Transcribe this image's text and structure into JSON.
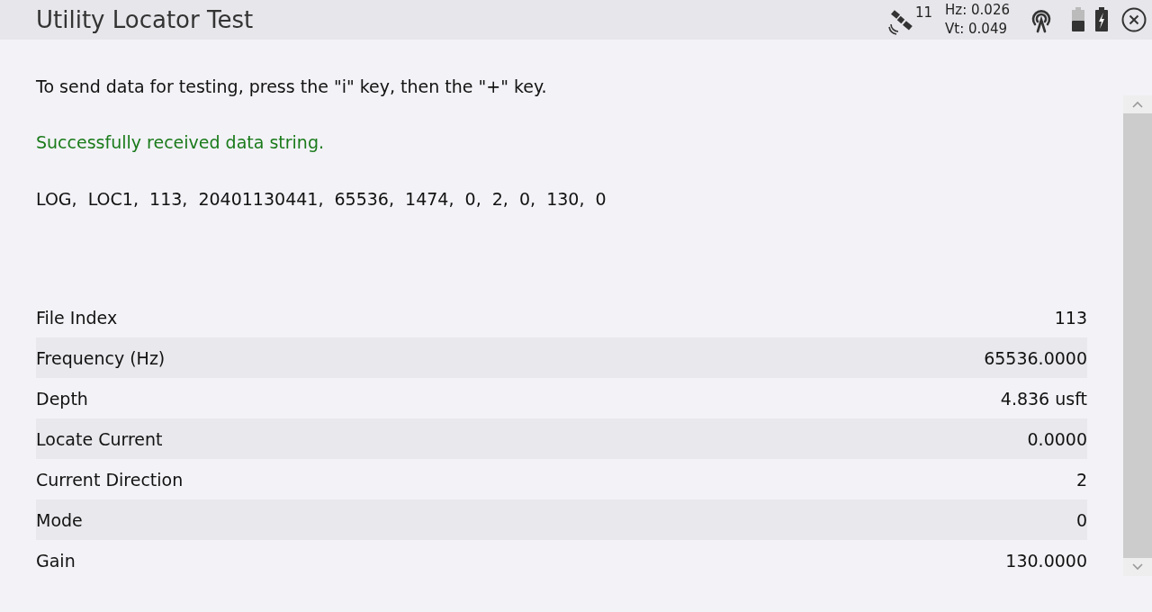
{
  "window": {
    "title": "Utility Locator Test"
  },
  "status": {
    "satellites": "11",
    "hz": "Hz: 0.026",
    "vt": "Vt: 0.049"
  },
  "instruction": "To send data for testing, press the \"i\" key, then the \"+\" key.",
  "result": "Successfully received data string.",
  "data_string": "LOG,  LOC1,  113,  20401130441,  65536,  1474,  0,  2,  0,  130,  0",
  "fields": [
    {
      "label": "File Index",
      "value": "113"
    },
    {
      "label": "Frequency (Hz)",
      "value": "65536.0000"
    },
    {
      "label": "Depth",
      "value": "4.836 usft"
    },
    {
      "label": "Locate Current",
      "value": "0.0000"
    },
    {
      "label": "Current Direction",
      "value": "2"
    },
    {
      "label": "Mode",
      "value": "0"
    },
    {
      "label": "Gain",
      "value": "130.0000"
    }
  ]
}
